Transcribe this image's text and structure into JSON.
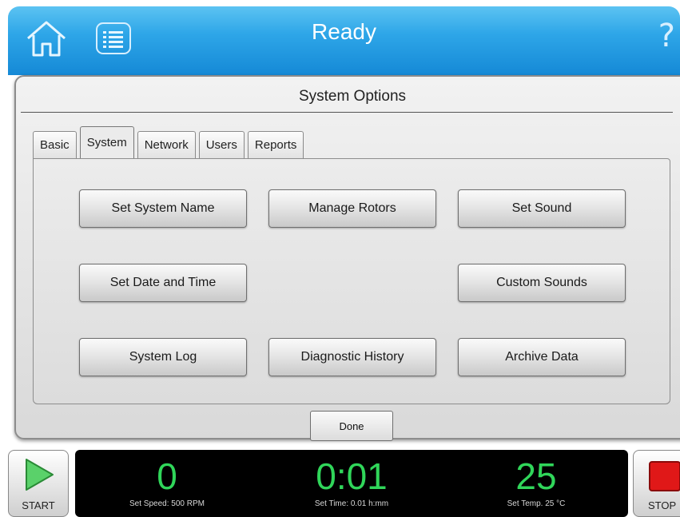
{
  "header": {
    "title": "Ready",
    "home_icon": "home-icon",
    "menu_icon": "list-menu-icon",
    "help_label": "?",
    "colors": {
      "top": "#5cc3f2",
      "bottom": "#1589d6"
    }
  },
  "dialog": {
    "title": "System Options",
    "tabs": [
      {
        "label": "Basic"
      },
      {
        "label": "System",
        "active": true
      },
      {
        "label": "Network"
      },
      {
        "label": "Users"
      },
      {
        "label": "Reports"
      }
    ],
    "buttons": {
      "set_system_name": "Set System Name",
      "manage_rotors": "Manage Rotors",
      "set_sound": "Set Sound",
      "set_date_time": "Set Date and Time",
      "custom_sounds": "Custom Sounds",
      "system_log": "System Log",
      "diagnostic_history": "Diagnostic History",
      "archive_data": "Archive Data"
    },
    "done_label": "Done"
  },
  "controls": {
    "start_label": "START",
    "stop_label": "STOP",
    "start_icon": "play-triangle-icon",
    "stop_icon": "stop-square-icon",
    "accent_green": "#30d65a",
    "stop_red": "#e01818"
  },
  "status": {
    "speed_value": "0",
    "speed_label": "Set Speed: 500 RPM",
    "time_value": "0:01",
    "time_label": "Set Time: 0.01 h:mm",
    "temp_value": "25",
    "temp_label": "Set Temp. 25 °C"
  }
}
